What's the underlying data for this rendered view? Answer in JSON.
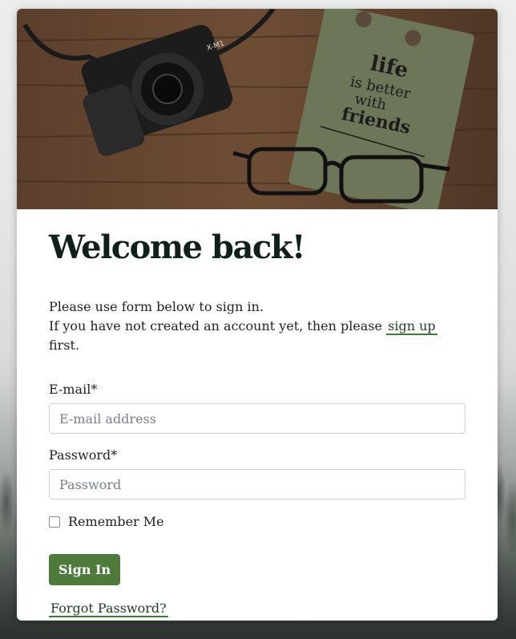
{
  "hero": {
    "notebook_text": [
      "life",
      "is better",
      "with",
      "friends"
    ],
    "camera_model": "X-M1"
  },
  "heading": "Welcome back!",
  "intro": {
    "line1": "Please use form below to sign in.",
    "line2_before": "If you have not created an account yet, then please",
    "signup_link": "sign up",
    "line2_after": "first."
  },
  "email": {
    "label": "E-mail*",
    "placeholder": "E-mail address",
    "value": ""
  },
  "password": {
    "label": "Password*",
    "placeholder": "Password",
    "value": ""
  },
  "remember": {
    "label": "Remember Me",
    "checked": false
  },
  "sign_in_button": "Sign In",
  "forgot_link": "Forgot Password?",
  "colors": {
    "primary_button": "#4e7a3c",
    "link_underline": "#3f7a3a",
    "heading": "#12201a"
  }
}
